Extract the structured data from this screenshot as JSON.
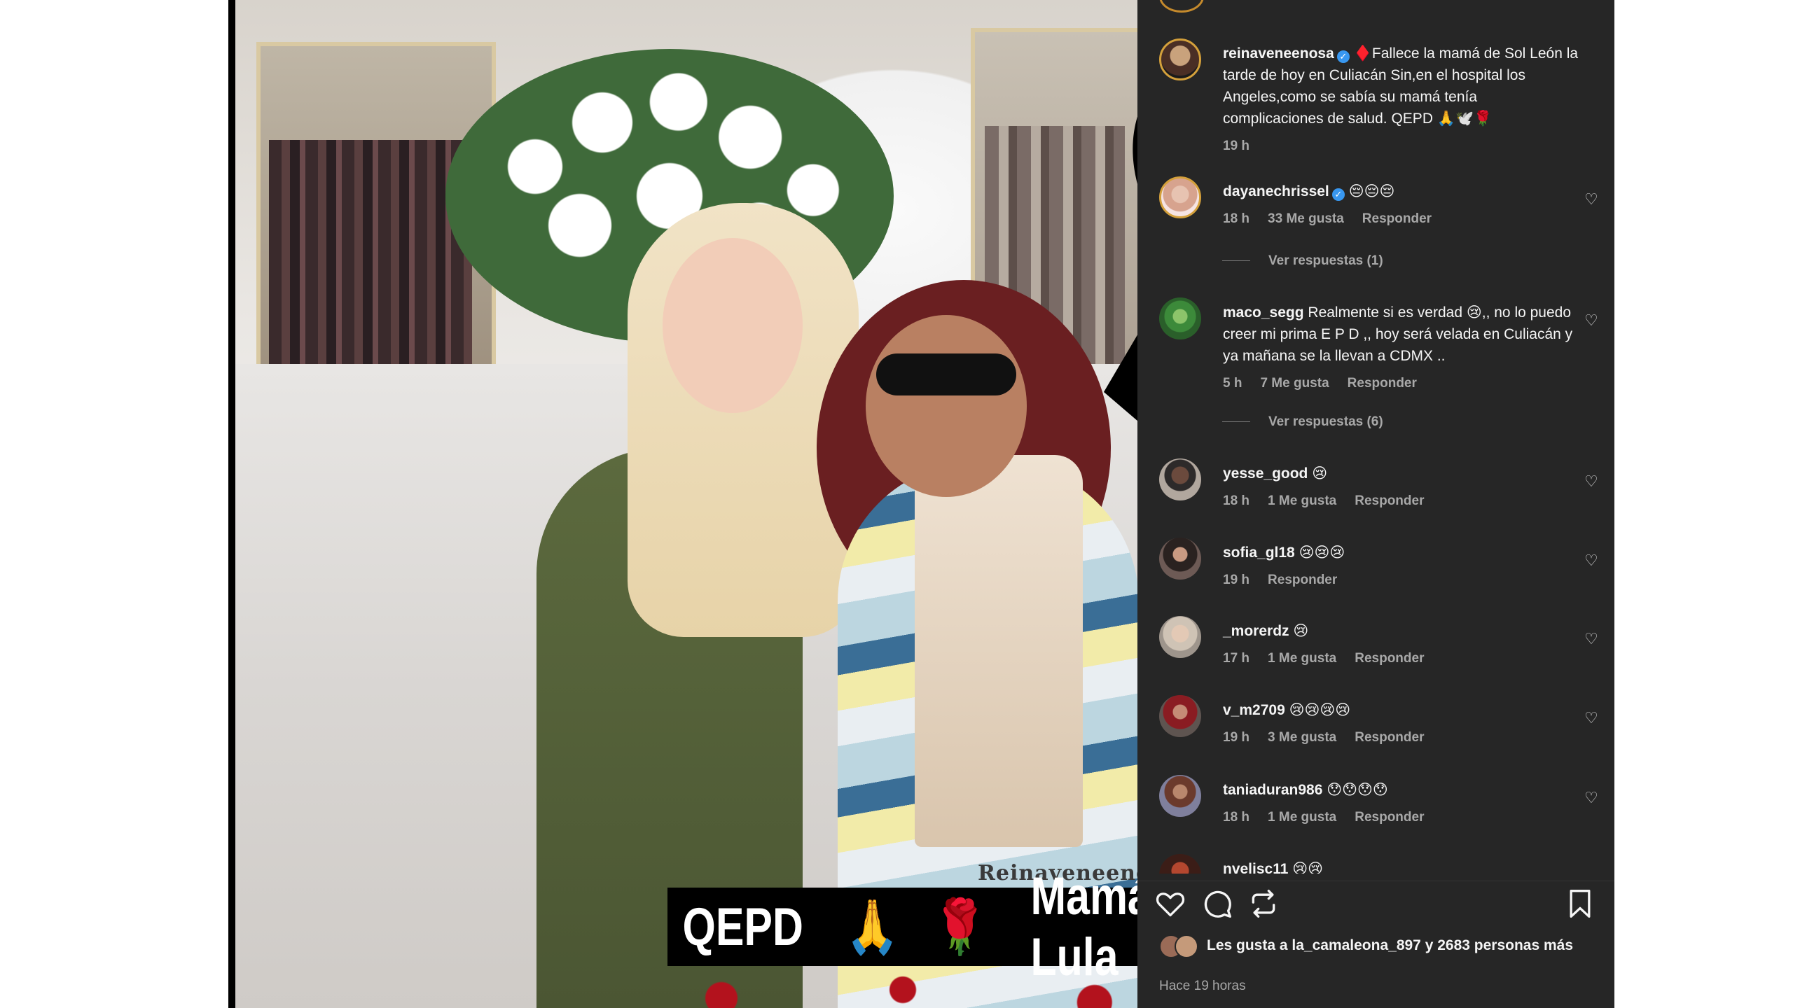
{
  "photo": {
    "watermark": "Reinaveneenosa",
    "banner_left": "QEPD",
    "banner_praying": "🙏",
    "banner_rose": "🌹",
    "banner_right": "Mamá Lula"
  },
  "caption": {
    "username": "reinaveneenosa",
    "verified": true,
    "text": "♦️Fallece la mamá de Sol León la tarde de hoy en Culiacán Sin,en el hospital los Angeles,como se sabía su mamá tenía complicaciones de salud. QEPD 🙏🕊️🌹",
    "time": "19 h"
  },
  "comments": [
    {
      "username": "dayanechrissel",
      "verified": true,
      "text": "😔😔😔",
      "time": "18 h",
      "likes": "33 Me gusta",
      "reply": "Responder",
      "replies": "Ver respuestas (1)"
    },
    {
      "username": "maco_segg",
      "verified": false,
      "text": "Realmente si es verdad 😢,, no lo puedo creer mi prima E P D ,, hoy será velada en Culiacán y ya mañana se la llevan a CDMX ..",
      "time": "5 h",
      "likes": "7 Me gusta",
      "reply": "Responder",
      "replies": "Ver respuestas (6)"
    },
    {
      "username": "yesse_good",
      "verified": false,
      "text": "😢",
      "time": "18 h",
      "likes": "1 Me gusta",
      "reply": "Responder"
    },
    {
      "username": "sofia_gl18",
      "verified": false,
      "text": "😢😢😢",
      "time": "19 h",
      "likes": "",
      "reply": "Responder"
    },
    {
      "username": "_morerdz",
      "verified": false,
      "text": "😢",
      "time": "17 h",
      "likes": "1 Me gusta",
      "reply": "Responder"
    },
    {
      "username": "v_m2709",
      "verified": false,
      "text": "😢😢😢😢",
      "time": "19 h",
      "likes": "3 Me gusta",
      "reply": "Responder"
    },
    {
      "username": "taniaduran986",
      "verified": false,
      "text": "😯😯😯😯",
      "time": "18 h",
      "likes": "1 Me gusta",
      "reply": "Responder"
    },
    {
      "username": "nvelisc11",
      "verified": false,
      "text": "😢😢",
      "time": "",
      "likes": "",
      "reply": ""
    }
  ],
  "likes_line": {
    "prefix": "Les gusta a ",
    "user": "la_camaleona_897",
    "suffix": " y 2683 personas más"
  },
  "posted": "Hace 19 horas",
  "icons": {
    "like": "heart-icon",
    "comment": "comment-icon",
    "share": "repost-icon",
    "save": "bookmark-icon"
  },
  "colors": {
    "panel_bg": "#262626",
    "verified": "#3897f0",
    "muted_text": "#a8a8a8",
    "avatar_ring": "#d4a03b"
  }
}
